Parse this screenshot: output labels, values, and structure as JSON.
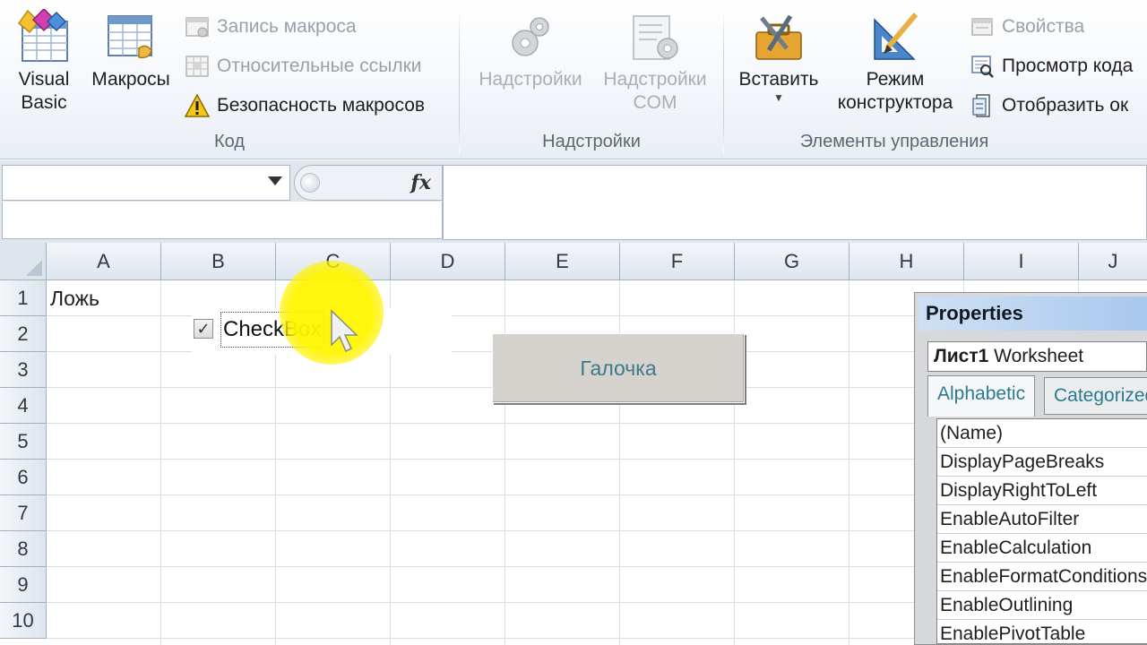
{
  "ribbon": {
    "code_group": {
      "label": "Код",
      "visual_basic": "Visual\nBasic",
      "macros": "Макросы",
      "record_macro": "Запись макроса",
      "relative_refs": "Относительные ссылки",
      "macro_security": "Безопасность макросов"
    },
    "addins_group": {
      "label": "Надстройки",
      "addins": "Надстройки",
      "com_addins_line1": "Надстройки",
      "com_addins_line2": "COM"
    },
    "controls_group": {
      "label": "Элементы управления",
      "insert": "Вставить",
      "design_mode_line1": "Режим",
      "design_mode_line2": "конструктора",
      "properties": "Свойства",
      "view_code": "Просмотр кода",
      "run_dialog": "Отобразить ок"
    }
  },
  "formula_bar": {
    "namebox_value": "",
    "fx": "fx",
    "formula_value": ""
  },
  "sheet": {
    "columns": [
      "A",
      "B",
      "C",
      "D",
      "E",
      "F",
      "G",
      "H",
      "I",
      "J"
    ],
    "rows": [
      "1",
      "2",
      "3",
      "4",
      "5",
      "6",
      "7",
      "8",
      "9",
      "10"
    ],
    "cell_a1": "Ложь",
    "checkbox_label": "CheckBox",
    "checkbox_mark": "✓",
    "button_label": "Галочка"
  },
  "properties": {
    "title": "Properties",
    "object_name": "Лист1",
    "object_type": "Worksheet",
    "tabs": [
      "Alphabetic",
      "Categorized"
    ],
    "items": [
      "(Name)",
      "DisplayPageBreaks",
      "DisplayRightToLeft",
      "EnableAutoFilter",
      "EnableCalculation",
      "EnableFormatConditions",
      "EnableOutlining",
      "EnablePivotTable"
    ]
  },
  "colors": {
    "highlight": "#fff200",
    "button_text": "#3b7a8a",
    "tab_text": "#2b7a8f"
  }
}
